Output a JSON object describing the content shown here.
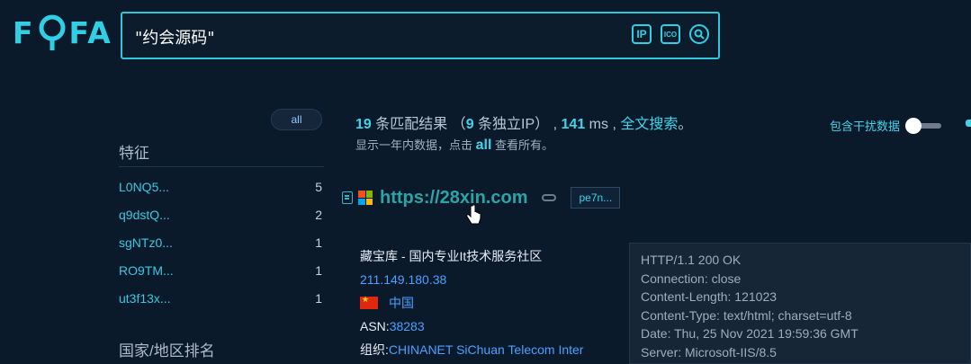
{
  "logo": {
    "text_left": "F",
    "text_right": "FA"
  },
  "search": {
    "value": "\"约会源码\"",
    "tools": {
      "ip": "IP",
      "ico": "ICO"
    }
  },
  "sidebar": {
    "all_label": "all",
    "features_title": "特征",
    "features": [
      {
        "name": "L0NQ5...",
        "count": "5"
      },
      {
        "name": "q9dstQ...",
        "count": "2"
      },
      {
        "name": "sgNTz0...",
        "count": "1"
      },
      {
        "name": "RO9TM...",
        "count": "1"
      },
      {
        "name": "ut3f13x...",
        "count": "1"
      }
    ],
    "region_title": "国家/地区排名"
  },
  "summary": {
    "count": "19",
    "count_text": " 条匹配结果 （",
    "unique_ip": "9",
    "unique_ip_text": " 条独立IP） , ",
    "ms": "141",
    "ms_text": " ms , ",
    "fulltext_link": "全文搜索",
    "end": "。",
    "note_prefix": "显示一年内数据，点击 ",
    "note_all": "all",
    "note_suffix": " 查看所有。"
  },
  "toggle": {
    "label": "包含干扰数据"
  },
  "result": {
    "url": "https://28xin.com",
    "tag": "pe7n...",
    "site_title": "藏宝库 - 国内专业It技术服务社区",
    "ip": "211.149.180.38",
    "country": "中国",
    "asn_label": "ASN: ",
    "asn": "38283",
    "org_label": "组织: ",
    "org": "CHINANET SiChuan Telecom Inter"
  },
  "headers": [
    "HTTP/1.1 200 OK",
    "Connection: close",
    "Content-Length: 121023",
    "Content-Type: text/html; charset=utf-8",
    "Date: Thu, 25 Nov 2021 19:59:36 GMT",
    "Server: Microsoft-IIS/8.5"
  ],
  "colors": {
    "accent": "#2fd0e6",
    "background": "#0b1a2b",
    "link": "#4aa0ff",
    "url_green": "#2aa4a6"
  }
}
